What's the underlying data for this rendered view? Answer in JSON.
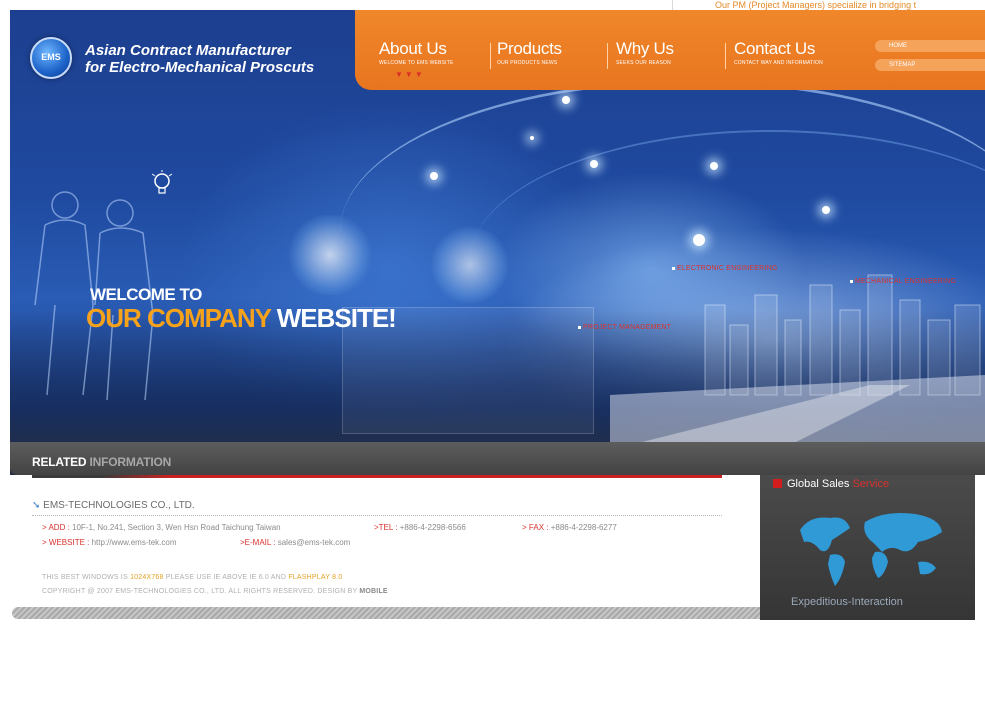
{
  "marquee": "Our PM (Project Managers) specialize in bridging t",
  "brand": {
    "logo_text": "EMS",
    "line1": "Asian Contract Manufacturer",
    "line2": "for Electro-Mechanical Proscuts"
  },
  "nav": [
    {
      "label": "About Us",
      "sub": "WELCOME TO EMS WEBSITE"
    },
    {
      "label": "Products",
      "sub": "OUR PRODUCTS NEWS"
    },
    {
      "label": "Why Us",
      "sub": "SEEKS OUR REASON"
    },
    {
      "label": "Contact Us",
      "sub": "CONTACT WAY AND INFORMATION"
    }
  ],
  "side_links": {
    "home": "HOME",
    "sitemap": "SITEMAP"
  },
  "nav_arrows": "▼▼▼",
  "hero": {
    "welcome_line1": "WELCOME TO",
    "welcome_orange": "OUR COMPANY",
    "welcome_white": "WEBSITE!",
    "labels": {
      "electronic": "ELECTRONIC ENGINEERING",
      "mechanical": "MECHANICAL ENGINEERING",
      "project": "PROJECT MANAGEMENT"
    }
  },
  "related": {
    "title_bold": "RELATED",
    "title_rest": "INFORMATION"
  },
  "company": {
    "name": "EMS-TECHNOLOGIES CO., LTD.",
    "add_label": "ADD",
    "add_value": "10F-1, No.241, Section 3, Wen Hsn Road Taichung Taiwan",
    "tel_label": "TEL",
    "tel_value": "+886-4-2298-6566",
    "fax_label": "FAX",
    "fax_value": "+886-4-2298-6277",
    "website_label": "WEBSITE",
    "website_value": "http://www.ems-tek.com",
    "email_label": "E-MAIL",
    "email_value": "sales@ems-tek.com"
  },
  "notes": {
    "line1_a": "THIS BEST WINDOWS IS",
    "line1_res": "1024X768",
    "line1_b": "PLEASE USE IE ABOVE IE 6.0 AND",
    "line1_flash": "FLASHPLAY 8.0",
    "line2": "COPYRIGHT @ 2007 EMS-TECHNOLOGIES CO., LTD.  ALL RIGHTS RESERVED.  DESIGN BY",
    "designer": "MOBILE"
  },
  "global": {
    "title_white": "Global Sales",
    "title_red": "Service",
    "footer": "Expeditious-Interaction"
  },
  "colors": {
    "nav_orange": "#e87520",
    "accent_red": "#d8322e",
    "hero_blue": "#1f4aa0",
    "highlight": "#f7a21b"
  }
}
